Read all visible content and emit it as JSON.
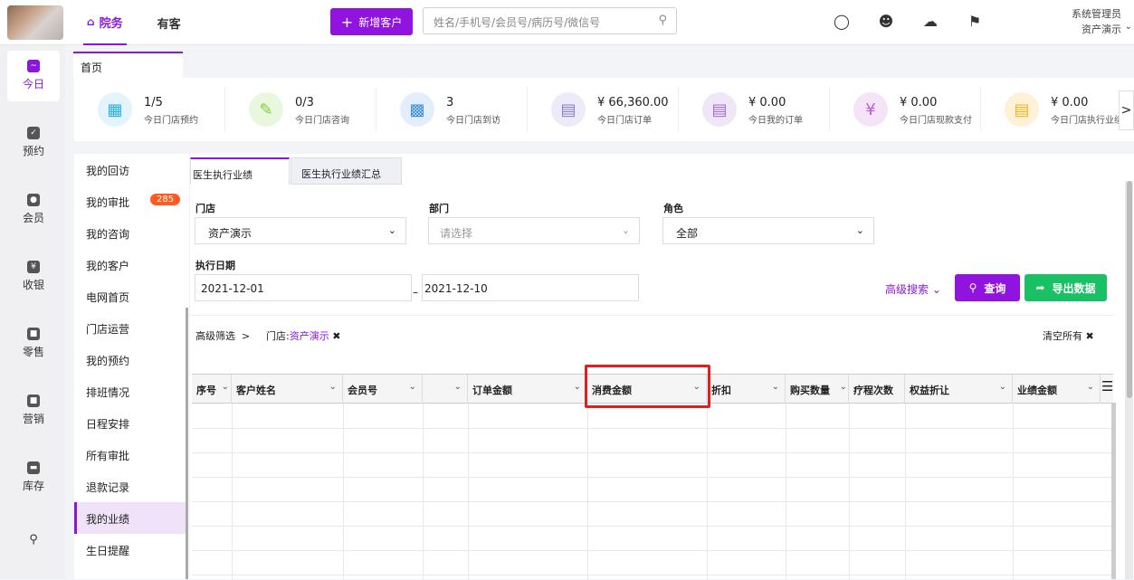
{
  "topnav": [
    {
      "label": "院务",
      "active": true
    },
    {
      "label": "有客",
      "active": false
    }
  ],
  "new_customer_button": "新增客户",
  "search": {
    "placeholder": "姓名/手机号/会员号/病历号/微信号"
  },
  "user": {
    "name": "系统管理员",
    "store": "资产演示"
  },
  "leftnav": [
    "今日",
    "预约",
    "会员",
    "收银",
    "零售",
    "营销",
    "库存",
    ""
  ],
  "home_tab": "首页",
  "stats": [
    {
      "value": "1/5",
      "label": "今日门店预约",
      "color": "#27b0e6"
    },
    {
      "value": "0/3",
      "label": "今日门店咨询",
      "color": "#7ccf3b"
    },
    {
      "value": "3",
      "label": "今日门店到访",
      "color": "#3b8de0"
    },
    {
      "value": "¥ 66,360.00",
      "label": "今日门店订单",
      "color": "#8a7ad6"
    },
    {
      "value": "¥ 0.00",
      "label": "今日我的订单",
      "color": "#a06ed8"
    },
    {
      "value": "¥ 0.00",
      "label": "今日门店现款支付",
      "color": "#c25ad6"
    },
    {
      "value": "¥ 0.00",
      "label": "今日门店执行业绩",
      "color": "#f2b322"
    }
  ],
  "submenu": [
    {
      "label": "我的回访"
    },
    {
      "label": "我的审批",
      "badge": "285"
    },
    {
      "label": "我的咨询"
    },
    {
      "label": "我的客户"
    },
    {
      "label": "电网首页"
    },
    {
      "label": "门店运营"
    },
    {
      "label": "我的预约"
    },
    {
      "label": "排班情况"
    },
    {
      "label": "日程安排"
    },
    {
      "label": "所有审批"
    },
    {
      "label": "退款记录"
    },
    {
      "label": "我的业绩",
      "active": true
    },
    {
      "label": "生日提醒"
    }
  ],
  "content_tabs": [
    "医生执行业绩",
    "医生执行业绩汇总"
  ],
  "filters": {
    "store_label": "门店",
    "store_value": "资产演示",
    "dept_label": "部门",
    "dept_placeholder": "请选择",
    "role_label": "角色",
    "role_value": "全部",
    "date_label": "执行日期",
    "date_from": "2021-12-01",
    "date_to": "2021-12-10",
    "advanced": "高级搜索",
    "query_button": "查询",
    "export_button": "导出数据"
  },
  "filterbar": {
    "label": "高级筛选",
    "chip_key": "门店:",
    "chip_value": "资产演示",
    "clear": "清空所有"
  },
  "columns": [
    "序号",
    "客户姓名",
    "会员号",
    "",
    "订单金额",
    "消费金额",
    "折扣",
    "购买数量",
    "疗程次数",
    "权益折让",
    "业绩金额"
  ],
  "highlighted_column": "消费金额"
}
